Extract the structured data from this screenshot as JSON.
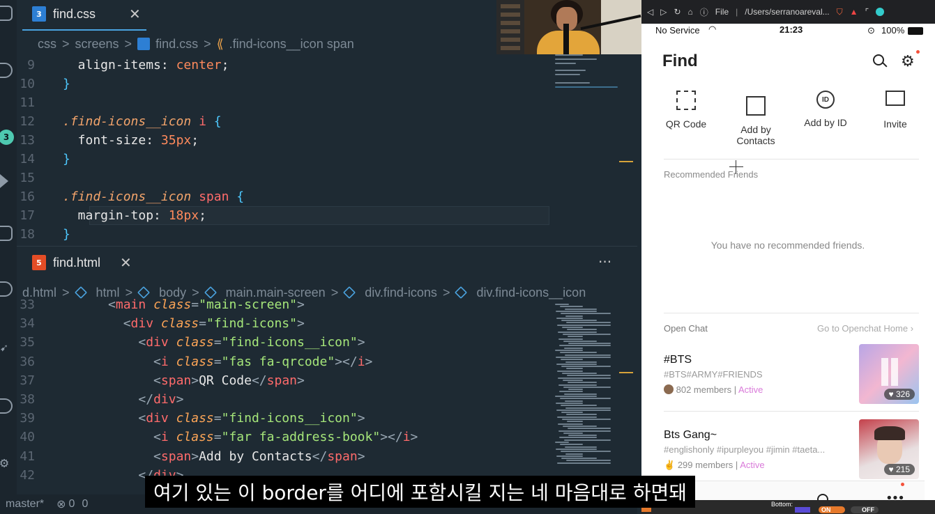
{
  "activity": {
    "badge": "3"
  },
  "css_tab": {
    "label": "find.css",
    "close": "✕"
  },
  "css_crumbs": {
    "a": "css",
    "b": "screens",
    "c": "find.css",
    "d": ".find-icons__icon span",
    "sep": ">"
  },
  "css_lines": [
    {
      "n": "9",
      "parts": [
        [
          "prop",
          "  align-items: "
        ],
        [
          "val",
          "center"
        ],
        [
          "prop",
          ";"
        ]
      ]
    },
    {
      "n": "10",
      "parts": [
        [
          "brace",
          "}"
        ]
      ]
    },
    {
      "n": "11",
      "parts": []
    },
    {
      "n": "12",
      "parts": [
        [
          "sel",
          ".find-icons__icon"
        ],
        [
          "prop",
          " "
        ],
        [
          "tag",
          "i"
        ],
        [
          "prop",
          " "
        ],
        [
          "brace",
          "{"
        ]
      ]
    },
    {
      "n": "13",
      "parts": [
        [
          "prop",
          "  font-size: "
        ],
        [
          "val",
          "35px"
        ],
        [
          "prop",
          ";"
        ]
      ]
    },
    {
      "n": "14",
      "parts": [
        [
          "brace",
          "}"
        ]
      ]
    },
    {
      "n": "15",
      "parts": []
    },
    {
      "n": "16",
      "parts": [
        [
          "sel",
          ".find-icons__icon"
        ],
        [
          "prop",
          " "
        ],
        [
          "tag",
          "span"
        ],
        [
          "prop",
          " "
        ],
        [
          "brace",
          "{"
        ]
      ]
    },
    {
      "n": "17",
      "parts": [
        [
          "prop",
          "  margin-top: "
        ],
        [
          "val",
          "18px"
        ],
        [
          "prop",
          ";"
        ]
      ]
    },
    {
      "n": "18",
      "parts": [
        [
          "brace",
          "}"
        ]
      ]
    }
  ],
  "html_tab": {
    "label": "find.html",
    "close": "✕",
    "more": "···"
  },
  "html_crumbs": {
    "a": "d.html",
    "b": "html",
    "c": "body",
    "d": "main.main-screen",
    "e": "div.find-icons",
    "f": "div.find-icons__icon",
    "sep": ">"
  },
  "html_lines": [
    {
      "n": "33",
      "parts": [
        [
          "txt",
          "      "
        ],
        [
          "pun",
          "<"
        ],
        [
          "tag",
          "main"
        ],
        [
          "txt",
          " "
        ],
        [
          "attr",
          "class"
        ],
        [
          "pun",
          "="
        ],
        [
          "str",
          "\"main-screen\""
        ],
        [
          "pun",
          ">"
        ]
      ]
    },
    {
      "n": "34",
      "parts": [
        [
          "txt",
          "        "
        ],
        [
          "pun",
          "<"
        ],
        [
          "tag",
          "div"
        ],
        [
          "txt",
          " "
        ],
        [
          "attr",
          "class"
        ],
        [
          "pun",
          "="
        ],
        [
          "str",
          "\"find-icons\""
        ],
        [
          "pun",
          ">"
        ]
      ]
    },
    {
      "n": "35",
      "parts": [
        [
          "txt",
          "          "
        ],
        [
          "pun",
          "<"
        ],
        [
          "tag",
          "div"
        ],
        [
          "txt",
          " "
        ],
        [
          "attr",
          "class"
        ],
        [
          "pun",
          "="
        ],
        [
          "str",
          "\"find-icons__icon\""
        ],
        [
          "pun",
          ">"
        ]
      ]
    },
    {
      "n": "36",
      "parts": [
        [
          "txt",
          "            "
        ],
        [
          "pun",
          "<"
        ],
        [
          "tag",
          "i"
        ],
        [
          "txt",
          " "
        ],
        [
          "attr",
          "class"
        ],
        [
          "pun",
          "="
        ],
        [
          "str",
          "\"fas fa-qrcode\""
        ],
        [
          "pun",
          "></"
        ],
        [
          "tag",
          "i"
        ],
        [
          "pun",
          ">"
        ]
      ]
    },
    {
      "n": "37",
      "parts": [
        [
          "txt",
          "            "
        ],
        [
          "pun",
          "<"
        ],
        [
          "tag",
          "span"
        ],
        [
          "pun",
          ">"
        ],
        [
          "txt",
          "QR Code"
        ],
        [
          "pun",
          "</"
        ],
        [
          "tag",
          "span"
        ],
        [
          "pun",
          ">"
        ]
      ]
    },
    {
      "n": "38",
      "parts": [
        [
          "txt",
          "          "
        ],
        [
          "pun",
          "</"
        ],
        [
          "tag",
          "div"
        ],
        [
          "pun",
          ">"
        ]
      ]
    },
    {
      "n": "39",
      "parts": [
        [
          "txt",
          "          "
        ],
        [
          "pun",
          "<"
        ],
        [
          "tag",
          "div"
        ],
        [
          "txt",
          " "
        ],
        [
          "attr",
          "class"
        ],
        [
          "pun",
          "="
        ],
        [
          "str",
          "\"find-icons__icon\""
        ],
        [
          "pun",
          ">"
        ]
      ]
    },
    {
      "n": "40",
      "parts": [
        [
          "txt",
          "            "
        ],
        [
          "pun",
          "<"
        ],
        [
          "tag",
          "i"
        ],
        [
          "txt",
          " "
        ],
        [
          "attr",
          "class"
        ],
        [
          "pun",
          "="
        ],
        [
          "str",
          "\"far fa-address-book\""
        ],
        [
          "pun",
          "></"
        ],
        [
          "tag",
          "i"
        ],
        [
          "pun",
          ">"
        ]
      ]
    },
    {
      "n": "41",
      "parts": [
        [
          "txt",
          "            "
        ],
        [
          "pun",
          "<"
        ],
        [
          "tag",
          "span"
        ],
        [
          "pun",
          ">"
        ],
        [
          "txt",
          "Add by Contacts"
        ],
        [
          "pun",
          "</"
        ],
        [
          "tag",
          "span"
        ],
        [
          "pun",
          ">"
        ]
      ]
    },
    {
      "n": "42",
      "parts": [
        [
          "txt",
          "          "
        ],
        [
          "pun",
          "</"
        ],
        [
          "tag",
          "div"
        ],
        [
          "pun",
          ">"
        ]
      ]
    }
  ],
  "status": {
    "branch": "master*",
    "errors": "0",
    "warnings": "0"
  },
  "browser": {
    "file_label": "File",
    "url": "/Users/serranoareval..."
  },
  "phone": {
    "carrier": "No Service",
    "time": "21:23",
    "battery": "100%",
    "title": "Find",
    "icons": [
      {
        "glyph": "",
        "label": "QR Code"
      },
      {
        "glyph": "",
        "label": "Add by Contacts"
      },
      {
        "glyph": "ID",
        "label": "Add by ID"
      },
      {
        "glyph": "",
        "label": "Invite"
      }
    ],
    "recommended_title": "Recommended Friends",
    "empty_text": "You have no recommended friends.",
    "openchat_title": "Open Chat",
    "openchat_link": "Go to Openchat Home",
    "chats": [
      {
        "title": "#BTS",
        "tags": "#BTS#ARMY#FRIENDS",
        "members": "802 members",
        "status": "Active",
        "likes": "326"
      },
      {
        "title": "Bts Gang~",
        "tags": "#englishonly #ipurpleyou #jimin #taeta...",
        "members": "299 members",
        "status": "Active",
        "likes": "215"
      }
    ]
  },
  "bottom_toggles": {
    "label": "Bottom:",
    "on": "ON",
    "off": "OFF"
  },
  "subtitle": "여기 있는 이 border를 어디에 포함시킬 지는 네 마음대로 하면돼",
  "colors": {
    "accent_css": "#4aa3e0",
    "accent_html": "#e44d26",
    "active": "#d97ad9"
  }
}
